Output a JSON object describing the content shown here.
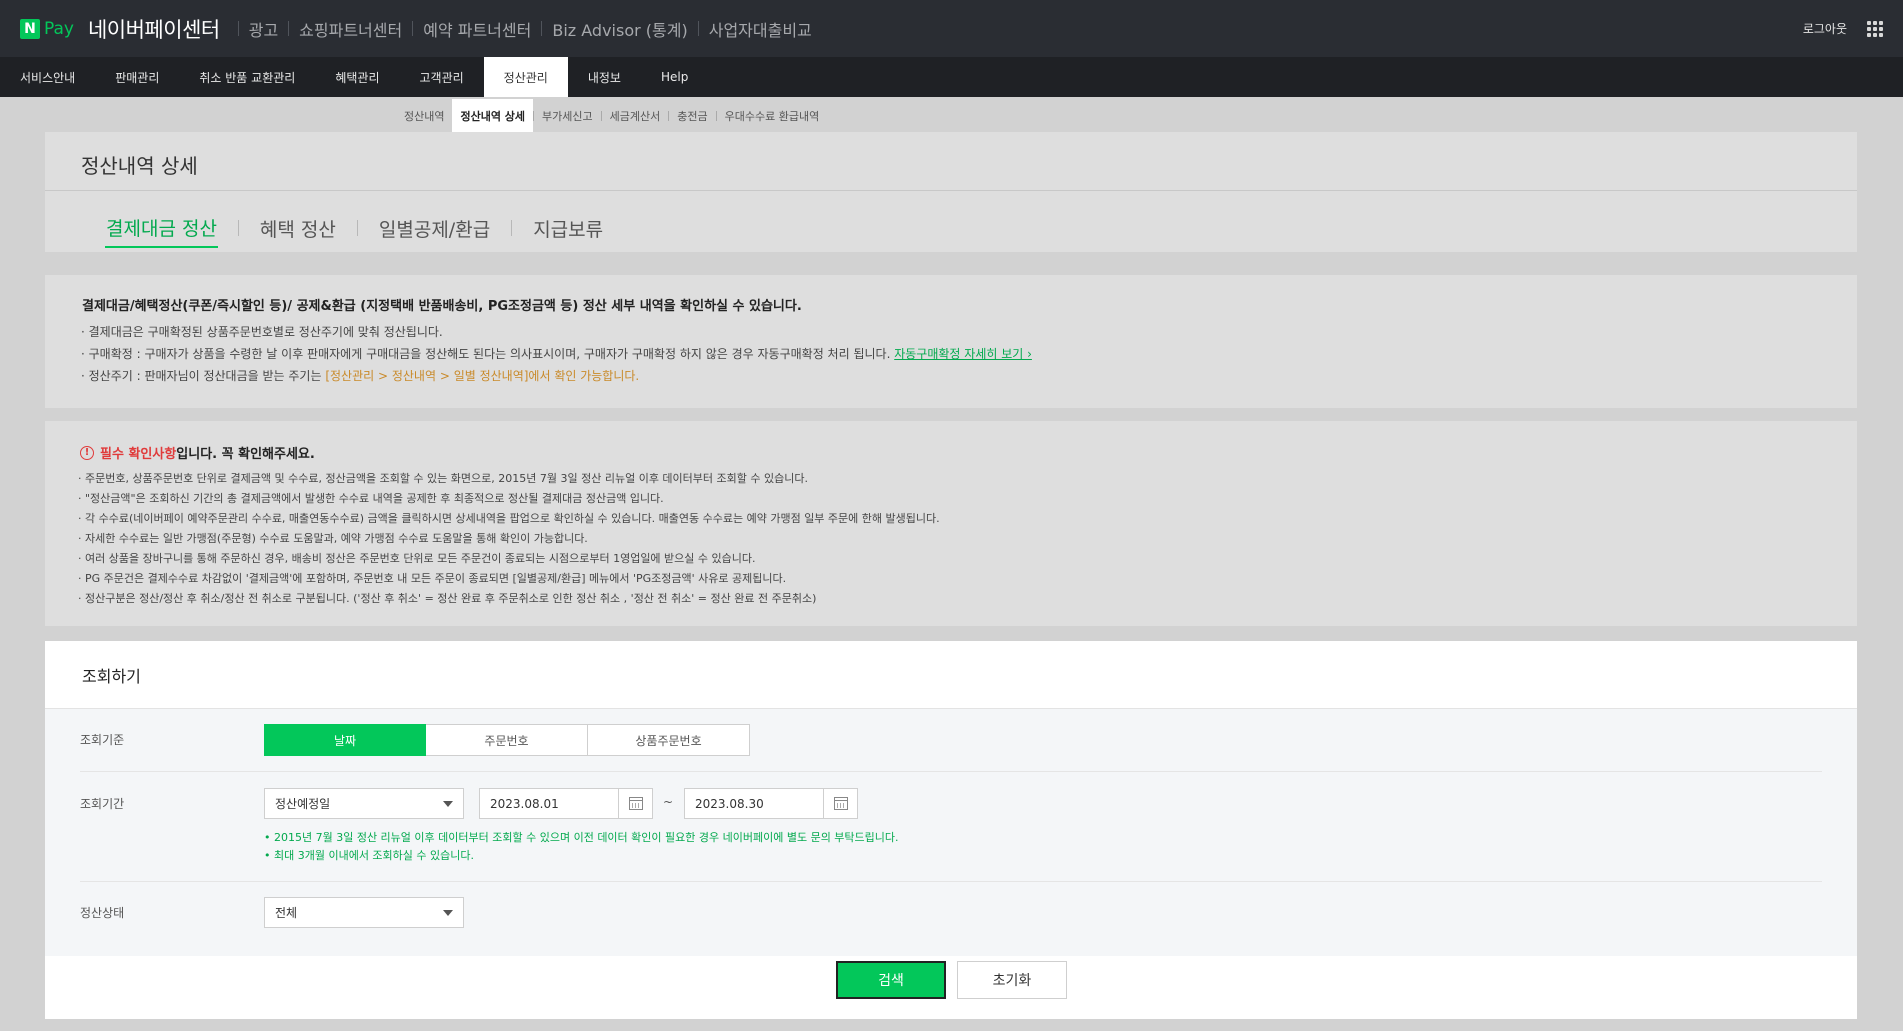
{
  "topbar": {
    "logo_n": "N",
    "logo_pay": "Pay",
    "brand": "네이버페이센터",
    "nav": [
      "광고",
      "쇼핑파트너센터",
      "예약 파트너센터",
      "Biz Advisor (통계)",
      "사업자대출비교"
    ],
    "logout": "로그아웃"
  },
  "mainnav": [
    "서비스안내",
    "판매관리",
    "취소 반품 교환관리",
    "혜택관리",
    "고객관리",
    "정산관리",
    "내정보",
    "Help"
  ],
  "subnav": [
    "정산내역",
    "정산내역 상세",
    "부가세신고",
    "세금계산서",
    "충전금",
    "우대수수료 환급내역"
  ],
  "page": {
    "title": "정산내역 상세",
    "tabs": [
      "결제대금 정산",
      "혜택 정산",
      "일별공제/환급",
      "지급보류"
    ]
  },
  "notice": {
    "head": "결제대금/혜택정산(쿠폰/즉시할인 등)/ 공제&환급 (지정택배 반품배송비, PG조정금액 등) 정산 세부 내역을 확인하실 수 있습니다.",
    "line1": "· 결제대금은 구매확정된 상품주문번호별로 정산주기에 맞춰 정산됩니다.",
    "line2": "· 구매확정 : 구매자가 상품을 수령한 날 이후 판매자에게 구매대금을 정산해도 된다는 의사표시이며, 구매자가 구매확정 하지 않은 경우 자동구매확정 처리 됩니다.",
    "line2_link": "자동구매확정 자세히 보기 ›",
    "line3_prefix": "· 정산주기 : 판매자님이 정산대금을 받는 주기는 ",
    "line3_highlight": "[정산관리 > 정산내역 > 일별 정산내역]에서 확인 가능합니다."
  },
  "required": {
    "head_red": "필수 확인사항",
    "head_rest": "입니다. 꼭 확인해주세요.",
    "lines": [
      "· 주문번호, 상품주문번호 단위로 결제금액 및 수수료, 정산금액을 조회할 수 있는 화면으로, 2015년 7월 3일 정산 리뉴얼 이후 데이터부터 조회할 수 있습니다.",
      "· \"정산금액\"은 조회하신 기간의 총 결제금액에서 발생한 수수료 내역을 공제한 후 최종적으로 정산될 결제대금 정산금액 입니다.",
      "· 각 수수료(네이버페이 예약주문관리 수수료, 매출연동수수료) 금액을 클릭하시면 상세내역을 팝업으로 확인하실 수 있습니다. 매출연동 수수료는 예약 가맹점 일부 주문에 한해 발생됩니다.",
      "· 자세한 수수료는 일반 가맹점(주문형) 수수료 도움말과, 예약 가맹점 수수료 도움말을 통해 확인이 가능합니다.",
      "· 여러 상품을 장바구니를 통해 주문하신 경우, 배송비 정산은 주문번호 단위로 모든 주문건이 종료되는 시점으로부터 1영업일에 받으실 수 있습니다.",
      "· PG 주문건은 결제수수료 차감없이 '결제금액'에 포함하며, 주문번호 내 모든 주문이 종료되면 [일별공제/환급] 메뉴에서 'PG조정금액' 사유로 공제됩니다.",
      "· 정산구분은 정산/정산 후 취소/정산 전 취소로 구분됩니다. ('정산 후 취소' = 정산 완료 후 주문취소로 인한 정산 취소 , '정산 전 취소' = 정산 완료 전 주문취소)"
    ]
  },
  "search": {
    "title": "조회하기",
    "criteria_label": "조회기준",
    "criteria_options": [
      "날짜",
      "주문번호",
      "상품주문번호"
    ],
    "period_label": "조회기간",
    "period_type": "정산예정일",
    "date_from": "2023.08.01",
    "date_to": "2023.08.30",
    "tilde": "~",
    "hint1": "• 2015년 7월 3일 정산 리뉴얼 이후 데이터부터 조회할 수 있으며 이전 데이터 확인이 필요한 경우 네이버페이에 별도 문의 부탁드립니다.",
    "hint2": "• 최대 3개월 이내에서 조회하실 수 있습니다.",
    "status_label": "정산상태",
    "status_value": "전체",
    "search_button": "검색",
    "reset_button": "초기화"
  },
  "colors": {
    "brand_green": "#03c75a",
    "topbar_bg": "#2a2d33",
    "alert_red": "#e03b3b"
  }
}
